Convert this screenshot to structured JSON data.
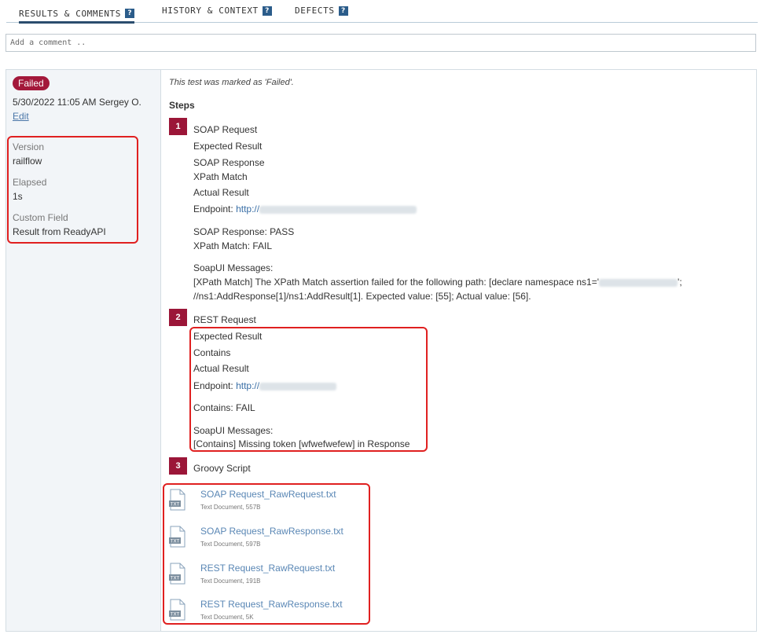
{
  "tabs": [
    {
      "label": "RESULTS & COMMENTS",
      "help": "?"
    },
    {
      "label": "HISTORY & CONTEXT",
      "help": "?"
    },
    {
      "label": "DEFECTS",
      "help": "?"
    }
  ],
  "comment": {
    "placeholder": "Add a comment .."
  },
  "sidebar": {
    "status_badge": "Failed",
    "date_user": "5/30/2022 11:05 AM Sergey O.",
    "edit": "Edit",
    "fields": [
      {
        "label": "Version",
        "value": "railflow"
      },
      {
        "label": "Elapsed",
        "value": "1s"
      },
      {
        "label": "Custom Field",
        "value": "Result from ReadyAPI"
      }
    ]
  },
  "main": {
    "status_text": "This test was marked as 'Failed'.",
    "steps_heading": "Steps",
    "steps": [
      {
        "number": "1",
        "title": "SOAP Request",
        "expected_label": "Expected Result",
        "soap_response": "SOAP Response",
        "xpath_match": "XPath Match",
        "actual_label": "Actual Result",
        "endpoint_label": "Endpoint:",
        "endpoint_link": "http://",
        "soap_response_result": "SOAP Response: PASS",
        "xpath_result": "XPath Match: FAIL",
        "messages_label": "SoapUI Messages:",
        "message_line1": "[XPath Match] The XPath Match assertion failed for the following path: [declare namespace ns1='",
        "message_line1_end": "';",
        "message_line2": "//ns1:AddResponse[1]/ns1:AddResult[1]. Expected value: [55]; Actual value: [56]."
      },
      {
        "number": "2",
        "title": "REST Request",
        "expected_label": "Expected Result",
        "contains": "Contains",
        "actual_label": "Actual Result",
        "endpoint_label": "Endpoint:",
        "endpoint_link": "http://",
        "contains_result": "Contains: FAIL",
        "messages_label": "SoapUI Messages:",
        "message_line1": "[Contains] Missing token [wfwefwefew] in Response"
      },
      {
        "number": "3",
        "title": "Groovy Script"
      }
    ],
    "attachments": [
      {
        "name": "SOAP Request_RawRequest.txt",
        "meta": "Text Document, 557B",
        "icon": "txt-file-icon"
      },
      {
        "name": "SOAP Request_RawResponse.txt",
        "meta": "Text Document, 597B",
        "icon": "txt-file-icon"
      },
      {
        "name": "REST Request_RawRequest.txt",
        "meta": "Text Document, 191B",
        "icon": "txt-file-icon"
      },
      {
        "name": "REST Request_RawResponse.txt",
        "meta": "Text Document, 5K",
        "icon": "txt-file-icon"
      }
    ],
    "file_icon_badge": "TXT"
  },
  "colors": {
    "failed": "#a3183a",
    "step_number": "#9b1638",
    "link": "#3a6fa6",
    "highlight": "#e02020"
  }
}
